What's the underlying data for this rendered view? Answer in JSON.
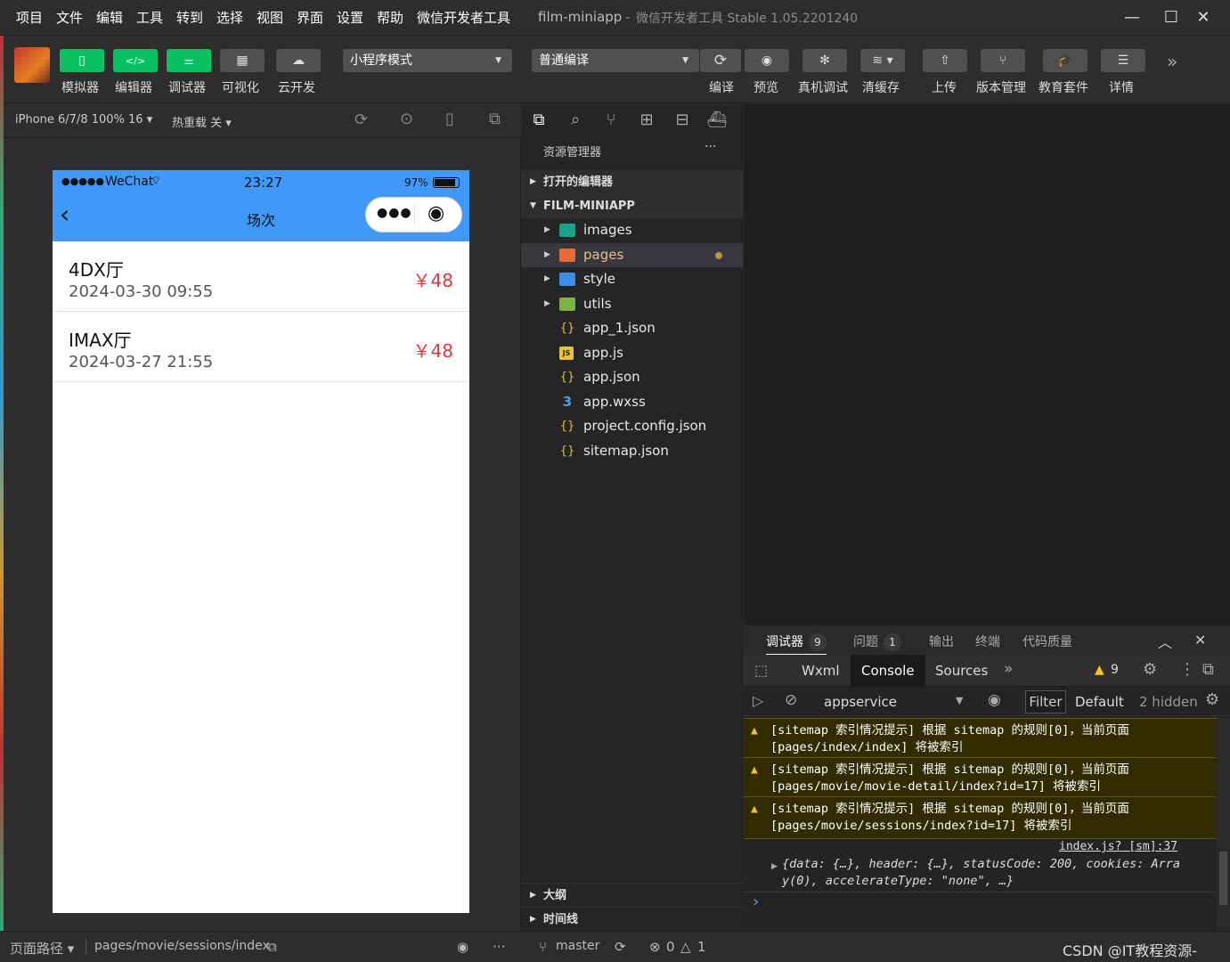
{
  "menu": [
    "项目",
    "文件",
    "编辑",
    "工具",
    "转到",
    "选择",
    "视图",
    "界面",
    "设置",
    "帮助",
    "微信开发者工具"
  ],
  "window": {
    "project": "film-miniapp",
    "separator": "-",
    "app": "微信开发者工具 Stable 1.05.2201240"
  },
  "toolbar": {
    "left_buttons": [
      "模拟器",
      "编辑器",
      "调试器",
      "可视化",
      "云开发"
    ],
    "mode_select": "小程序模式",
    "compile_select": "普通编译",
    "right_buttons": [
      "编译",
      "预览",
      "真机调试",
      "清缓存",
      "上传",
      "版本管理",
      "教育套件",
      "详情"
    ]
  },
  "simbar": {
    "device": "iPhone 6/7/8 100% 16",
    "hotreload": "热重载 关"
  },
  "phone": {
    "status_dots": "●●●●●",
    "carrier": "WeChat",
    "time": "23:27",
    "battery": "97%",
    "title": "场次",
    "sessions": [
      {
        "hall": "4DX厅",
        "time": "2024-03-30 09:55",
        "price": "￥48"
      },
      {
        "hall": "IMAX厅",
        "time": "2024-03-27 21:55",
        "price": "￥48"
      }
    ]
  },
  "explorer": {
    "title": "资源管理器",
    "more": "···",
    "open_editors": "打开的编辑器",
    "project": "FILM-MINIAPP",
    "items": [
      {
        "name": "images",
        "type": "folder"
      },
      {
        "name": "pages",
        "type": "folder"
      },
      {
        "name": "style",
        "type": "folder"
      },
      {
        "name": "utils",
        "type": "folder"
      },
      {
        "name": "app_1.json",
        "type": "json"
      },
      {
        "name": "app.js",
        "type": "js"
      },
      {
        "name": "app.json",
        "type": "json"
      },
      {
        "name": "app.wxss",
        "type": "css"
      },
      {
        "name": "project.config.json",
        "type": "json"
      },
      {
        "name": "sitemap.json",
        "type": "json"
      }
    ],
    "outline": "大纲",
    "timeline": "时间线"
  },
  "debugger": {
    "tabs": [
      {
        "label": "调试器",
        "badge": "9"
      },
      {
        "label": "问题",
        "badge": "1"
      },
      {
        "label": "输出"
      },
      {
        "label": "终端"
      },
      {
        "label": "代码质量"
      }
    ],
    "console_tabs": [
      "Wxml",
      "Console",
      "Sources"
    ],
    "warn_count": "9",
    "context": "appservice",
    "filter": "Filter",
    "levels": "Default",
    "hidden": "2 hidden",
    "messages": [
      {
        "l1": "[sitemap 索引情况提示] 根据 sitemap 的规则[0]，当前页面",
        "l2": "[pages/index/index] 将被索引"
      },
      {
        "l1": "[sitemap 索引情况提示] 根据 sitemap 的规则[0]，当前页面",
        "l2": "[pages/movie/movie-detail/index?id=17] 将被索引"
      },
      {
        "l1": "[sitemap 索引情况提示] 根据 sitemap 的规则[0]，当前页面",
        "l2": "[pages/movie/sessions/index?id=17] 将被索引"
      }
    ],
    "log_source": "index.js? [sm]:37",
    "log_line1": "{data: {…}, header: {…}, statusCode: 200, cookies: Arra",
    "log_line2": "y(0), accelerateType: \"none\", …}",
    "prompt": "›"
  },
  "status": {
    "path_label": "页面路径",
    "path": "pages/movie/sessions/index",
    "branch": "master",
    "errors": "0",
    "warnings": "1",
    "watermark": "CSDN @IT教程资源-"
  }
}
